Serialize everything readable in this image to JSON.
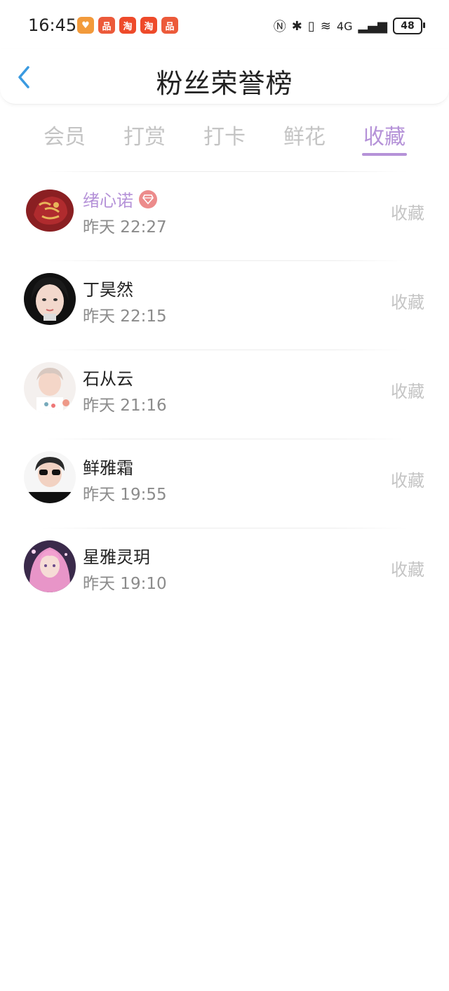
{
  "status_bar": {
    "time": "16:45",
    "network": "4G",
    "battery": "48",
    "app_icons": [
      {
        "name": "heart-app-icon",
        "label": "♥",
        "color": "#f29a3b"
      },
      {
        "name": "shop-app-icon",
        "label": "品",
        "color": "#ec5a3a"
      },
      {
        "name": "taobao-app-icon",
        "label": "淘",
        "color": "#ee4a2a"
      },
      {
        "name": "taobao-app-icon-2",
        "label": "淘",
        "color": "#ee4a2a"
      },
      {
        "name": "shop-app-icon-2",
        "label": "品",
        "color": "#ec5a3a"
      }
    ]
  },
  "header": {
    "title": "粉丝荣誉榜",
    "back_icon": "chevron-left-icon"
  },
  "tabs": [
    {
      "label": "会员",
      "active": false
    },
    {
      "label": "打赏",
      "active": false
    },
    {
      "label": "打卡",
      "active": false
    },
    {
      "label": "鲜花",
      "active": false
    },
    {
      "label": "收藏",
      "active": true
    }
  ],
  "list": [
    {
      "name": "绪心诺",
      "time": "昨天 22:27",
      "action": "收藏",
      "vip": true
    },
    {
      "name": "丁昊然",
      "time": "昨天 22:15",
      "action": "收藏",
      "vip": false
    },
    {
      "name": "石从云",
      "time": "昨天 21:16",
      "action": "收藏",
      "vip": false
    },
    {
      "name": "鲜雅霜",
      "time": "昨天 19:55",
      "action": "收藏",
      "vip": false
    },
    {
      "name": "星雅灵玥",
      "time": "昨天 19:10",
      "action": "收藏",
      "vip": false
    }
  ],
  "colors": {
    "accent": "#b592d8",
    "inactive_tab": "#c4c4c4",
    "back_icon": "#3a9ae0",
    "vip_badge": "#ec8b8b"
  }
}
